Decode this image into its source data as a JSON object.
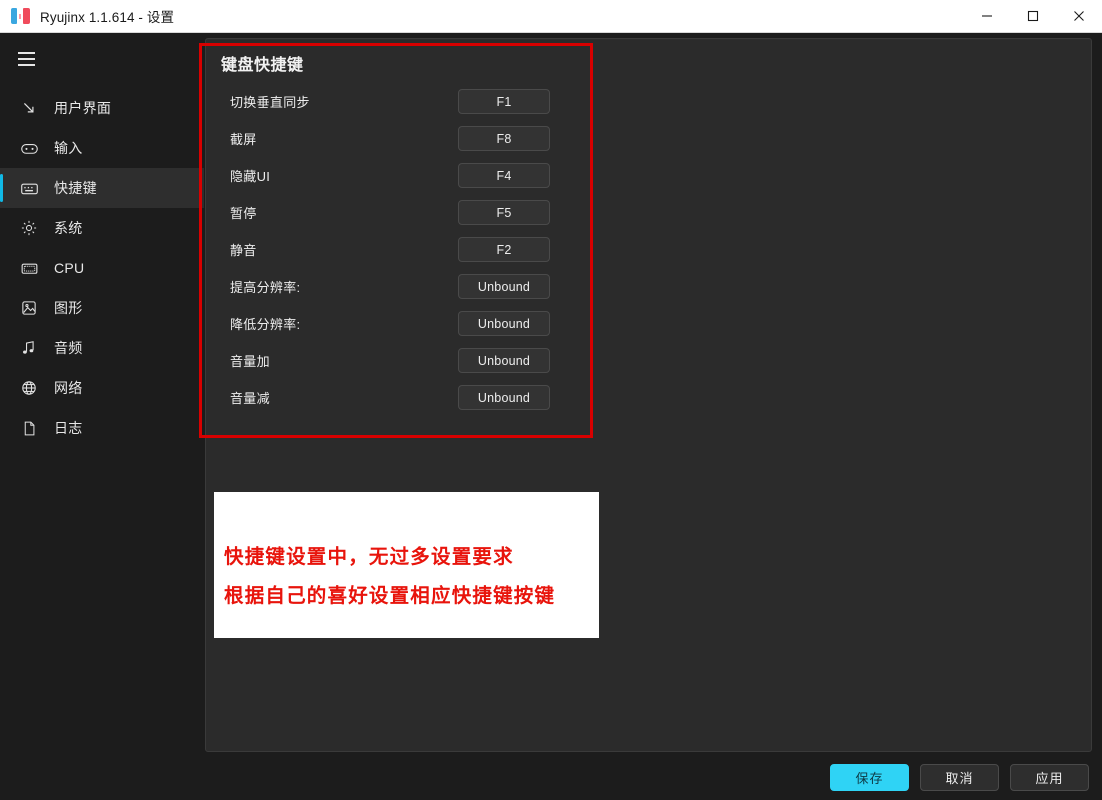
{
  "window": {
    "title": "Ryujinx 1.1.614 - 设置",
    "logo_icon": "ryujinx-logo-icon",
    "controls": {
      "minimize": "minimize-icon",
      "maximize": "maximize-icon",
      "close": "close-icon"
    }
  },
  "sidebar": {
    "menu_icon": "hamburger-icon",
    "items": [
      {
        "label": "用户界面",
        "icon": "ui-arrow-icon",
        "selected": false
      },
      {
        "label": "输入",
        "icon": "gamepad-icon",
        "selected": false
      },
      {
        "label": "快捷键",
        "icon": "keyboard-icon",
        "selected": true
      },
      {
        "label": "系统",
        "icon": "gear-icon",
        "selected": false
      },
      {
        "label": "CPU",
        "icon": "cpu-chip-icon",
        "selected": false
      },
      {
        "label": "图形",
        "icon": "image-icon",
        "selected": false
      },
      {
        "label": "音频",
        "icon": "music-note-icon",
        "selected": false
      },
      {
        "label": "网络",
        "icon": "globe-icon",
        "selected": false
      },
      {
        "label": "日志",
        "icon": "document-icon",
        "selected": false
      }
    ]
  },
  "main": {
    "section_title": "键盘快捷键",
    "hotkeys": [
      {
        "label": "切换垂直同步",
        "value": "F1"
      },
      {
        "label": "截屏",
        "value": "F8"
      },
      {
        "label": "隐藏UI",
        "value": "F4"
      },
      {
        "label": "暂停",
        "value": "F5"
      },
      {
        "label": "静音",
        "value": "F2"
      },
      {
        "label": "提高分辨率:",
        "value": "Unbound"
      },
      {
        "label": "降低分辨率:",
        "value": "Unbound"
      },
      {
        "label": "音量加",
        "value": "Unbound"
      },
      {
        "label": "音量减",
        "value": "Unbound"
      }
    ]
  },
  "annotations": {
    "highlight_color": "#d80000",
    "note_text_color": "#e8140c",
    "note_lines": [
      "快捷键设置中，无过多设置要求",
      "根据自己的喜好设置相应快捷键按键"
    ]
  },
  "footer": {
    "save_label": "保存",
    "cancel_label": "取消",
    "apply_label": "应用",
    "primary_color": "#2fd3f5"
  }
}
